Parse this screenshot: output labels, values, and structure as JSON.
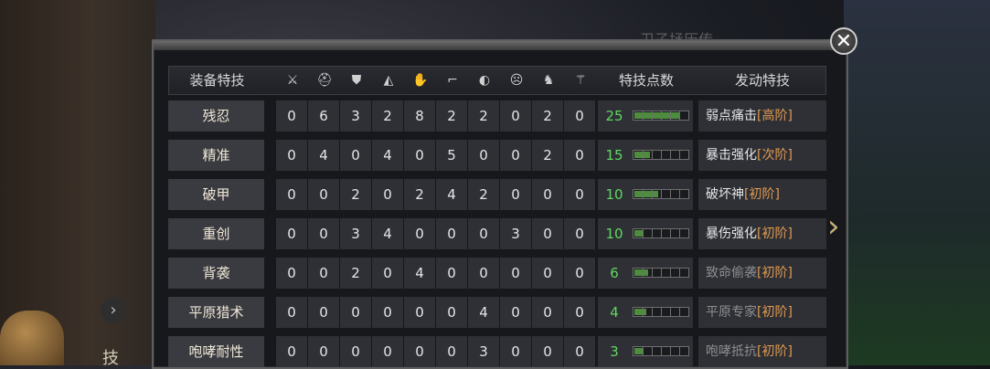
{
  "background_title": "卫子拯历传",
  "close_label": "✕",
  "header": {
    "left_label": "装备特技",
    "points_label": "特技点数",
    "skill_label": "发动特技",
    "icons": [
      "sword-icon",
      "helmet-icon",
      "armor-icon",
      "shoulder-icon",
      "glove-icon",
      "boot-icon",
      "cape-icon",
      "mask-icon",
      "horse-icon",
      "accessory-icon"
    ]
  },
  "rows": [
    {
      "name": "残忍",
      "values": [
        0,
        6,
        3,
        2,
        8,
        2,
        2,
        0,
        2,
        0
      ],
      "points": "25",
      "fill": 0.85,
      "skill": "弱点痛击",
      "tier": "[高阶]",
      "active": true
    },
    {
      "name": "精准",
      "values": [
        0,
        4,
        0,
        4,
        0,
        5,
        0,
        0,
        2,
        0
      ],
      "points": "15",
      "fill": 0.3,
      "skill": "暴击强化",
      "tier": "[次阶]",
      "active": true
    },
    {
      "name": "破甲",
      "values": [
        0,
        0,
        2,
        0,
        2,
        4,
        2,
        0,
        0,
        0
      ],
      "points": "10",
      "fill": 0.45,
      "skill": "破坏神",
      "tier": "[初阶]",
      "active": true
    },
    {
      "name": "重创",
      "values": [
        0,
        0,
        3,
        4,
        0,
        0,
        0,
        3,
        0,
        0
      ],
      "points": "10",
      "fill": 0.16,
      "skill": "暴伤强化",
      "tier": "[初阶]",
      "active": true
    },
    {
      "name": "背袭",
      "values": [
        0,
        0,
        2,
        0,
        4,
        0,
        0,
        0,
        0,
        0
      ],
      "points": "6",
      "fill": 0.25,
      "skill": "致命偷袭",
      "tier": "[初阶]",
      "active": false
    },
    {
      "name": "平原猎术",
      "values": [
        0,
        0,
        0,
        0,
        0,
        0,
        4,
        0,
        0,
        0
      ],
      "points": "4",
      "fill": 0.22,
      "skill": "平原专家",
      "tier": "[初阶]",
      "active": false
    },
    {
      "name": "咆哮耐性",
      "values": [
        0,
        0,
        0,
        0,
        0,
        0,
        3,
        0,
        0,
        0
      ],
      "points": "3",
      "fill": 0.16,
      "skill": "咆哮抵抗",
      "tier": "[初阶]",
      "active": false
    }
  ],
  "side": {
    "left_chevron": "›",
    "left_char": "技",
    "right_arrow": "›"
  }
}
